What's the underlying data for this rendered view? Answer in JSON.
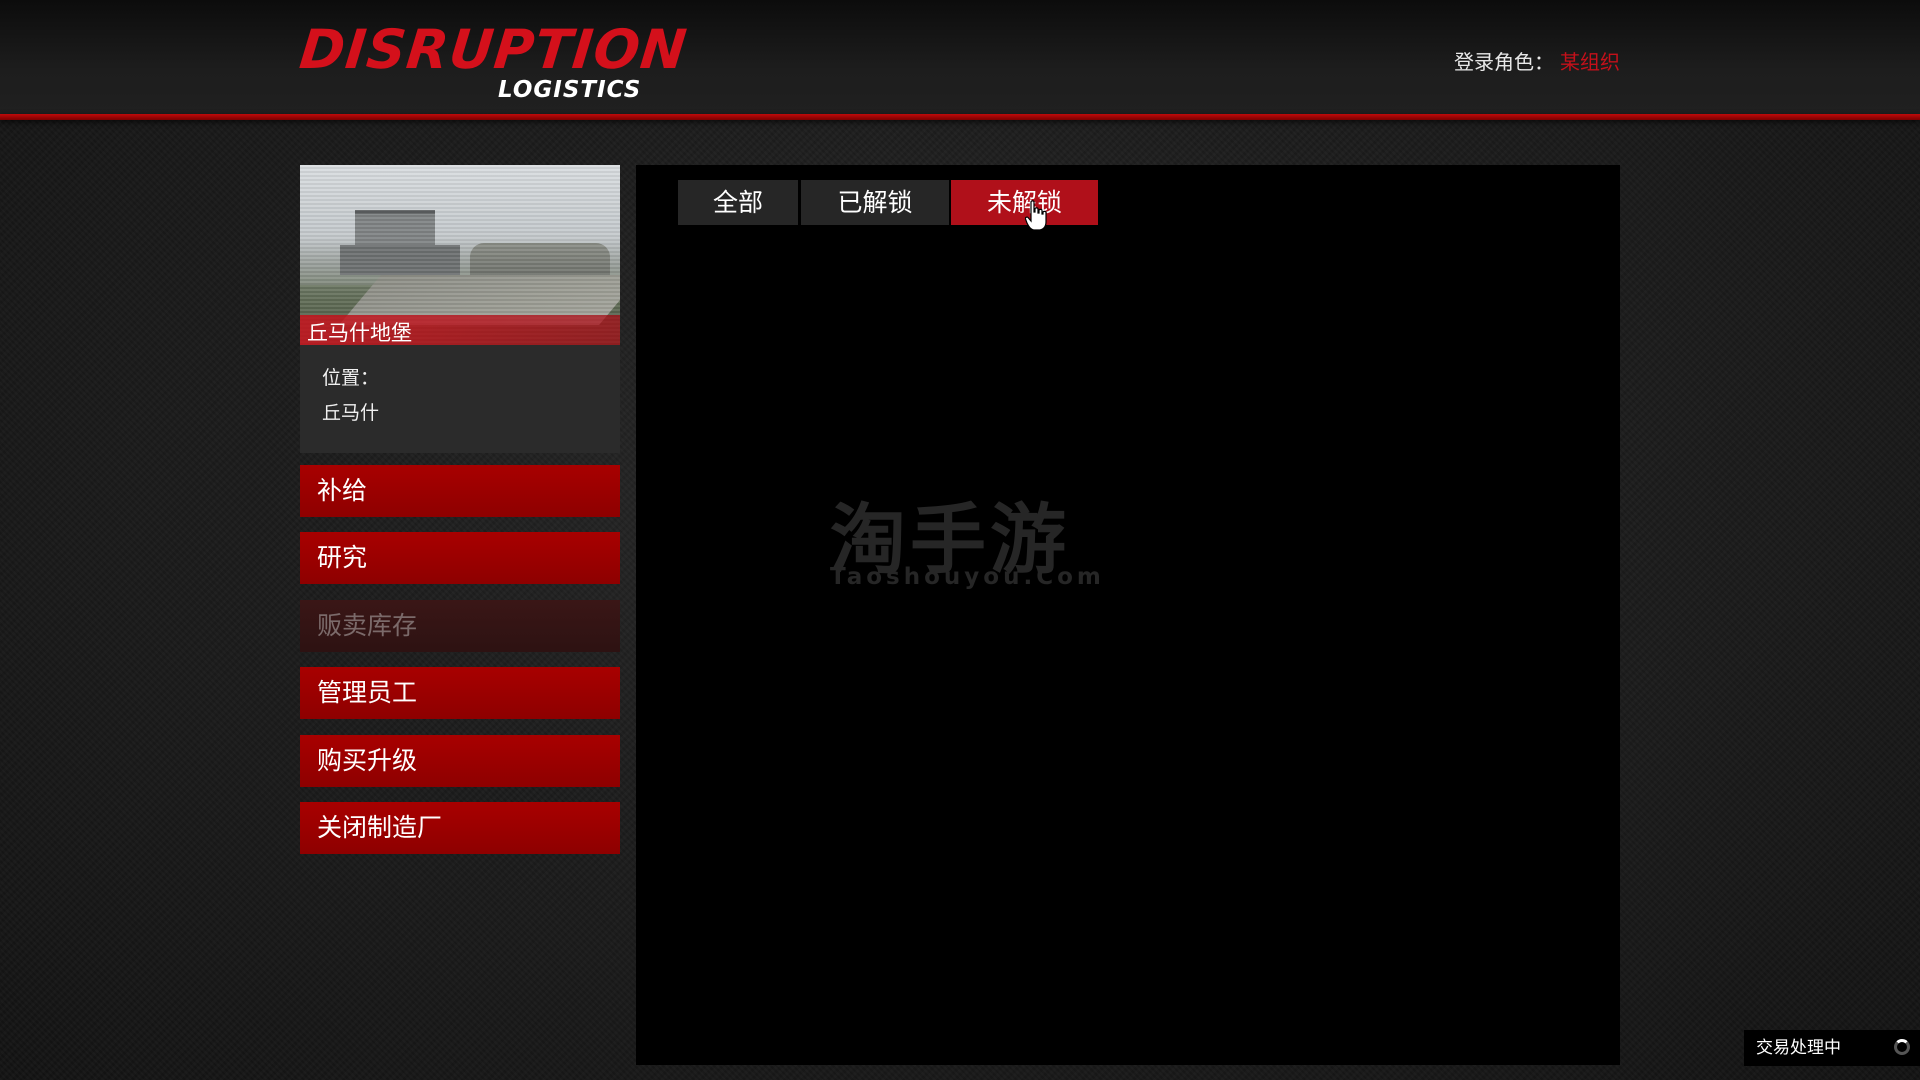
{
  "header": {
    "logo_main": "DISRUPTION",
    "logo_sub": "LOGISTICS",
    "login_label": "登录角色：",
    "login_org": "某组织",
    "accent_color": "#c4101a"
  },
  "property": {
    "name": "丘马什地堡",
    "location_label": "位置：",
    "location_value": "丘马什"
  },
  "sidebar": {
    "items": [
      {
        "label": "补给",
        "enabled": true
      },
      {
        "label": "研究",
        "enabled": true
      },
      {
        "label": "贩卖库存",
        "enabled": false
      },
      {
        "label": "管理员工",
        "enabled": true
      },
      {
        "label": "购买升级",
        "enabled": true
      },
      {
        "label": "关闭制造厂",
        "enabled": true
      }
    ]
  },
  "tabs": {
    "items": [
      {
        "label": "全部",
        "active": false
      },
      {
        "label": "已解锁",
        "active": false
      },
      {
        "label": "未解锁",
        "active": true
      }
    ]
  },
  "watermark": {
    "main": "淘手游",
    "sub": "Taoshouyou.Com"
  },
  "status": {
    "text": "交易处理中"
  }
}
